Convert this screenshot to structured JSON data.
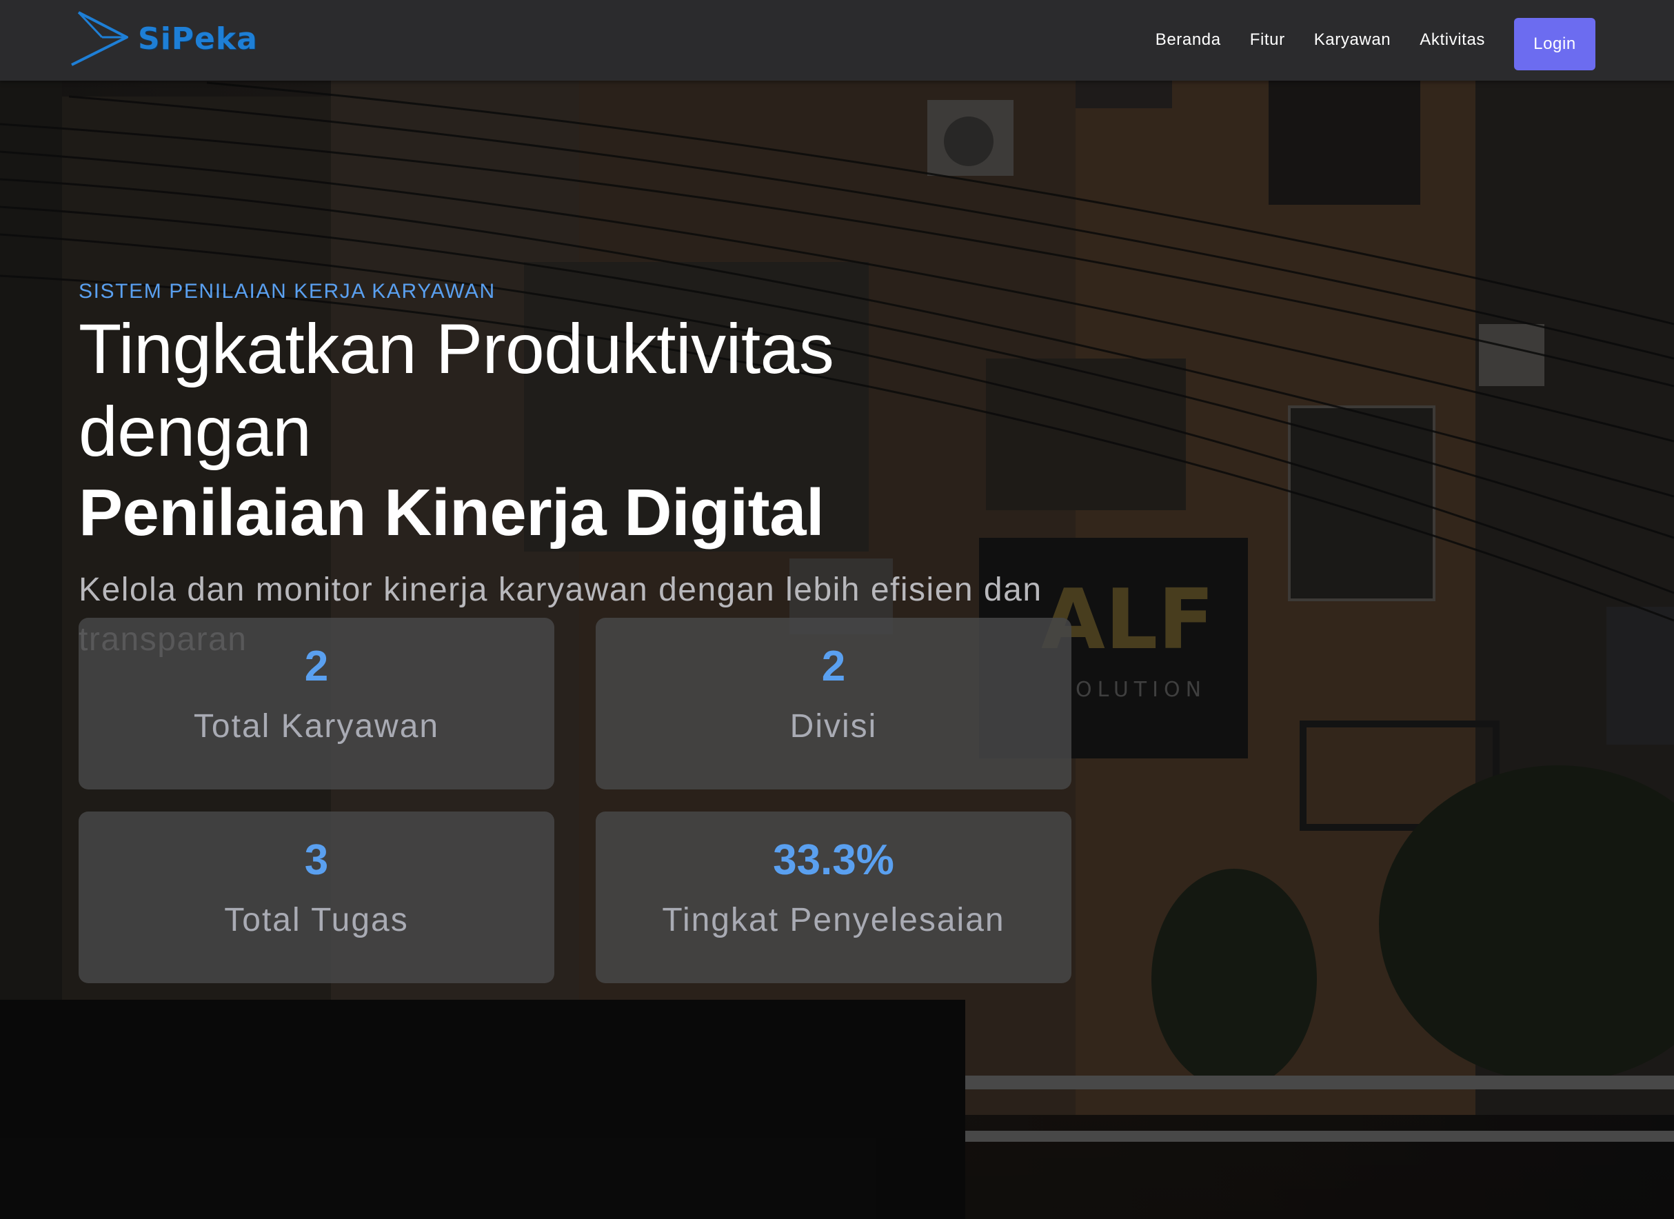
{
  "brand": {
    "name": "SiPeka",
    "color": "#1e7fd6"
  },
  "nav": {
    "links": [
      "Beranda",
      "Fitur",
      "Karyawan",
      "Aktivitas"
    ],
    "login_label": "Login",
    "login_color": "#6c6cf0"
  },
  "hero": {
    "eyebrow": "SISTEM PENILAIAN KERJA KARYAWAN",
    "headline_line1": "Tingkatkan Produktivitas dengan",
    "headline_line2": "Penilaian Kinerja Digital",
    "subtitle": "Kelola dan monitor kinerja karyawan dengan lebih efisien dan transparan"
  },
  "stats": [
    {
      "value": "2",
      "label": "Total Karyawan"
    },
    {
      "value": "2",
      "label": "Divisi"
    },
    {
      "value": "3",
      "label": "Total Tugas"
    },
    {
      "value": "33.3%",
      "label": "Tingkat Penyelesaian"
    }
  ],
  "accent_color": "#5aa0f0"
}
